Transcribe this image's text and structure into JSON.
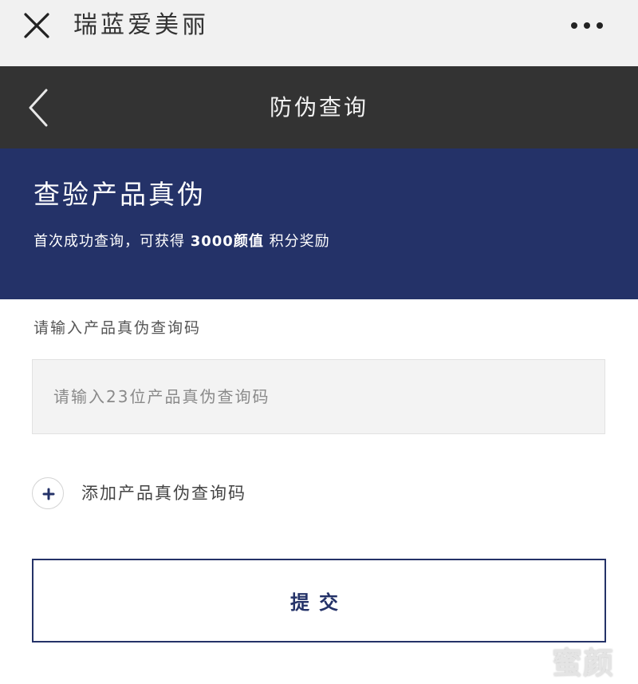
{
  "appbar": {
    "app_name": "瑞蓝爱美丽",
    "close_icon": "close-icon",
    "more_icon": "more-dots-icon"
  },
  "navbar": {
    "title": "防伪查询",
    "back_icon": "chevron-left-icon"
  },
  "banner": {
    "heading": "查验产品真伪",
    "sub_prefix": "首次成功查询，可获得 ",
    "sub_highlight": "3000颜值",
    "sub_suffix": " 积分奖励"
  },
  "form": {
    "label": "请输入产品真伪查询码",
    "input_value": "",
    "input_placeholder": "请输入23位产品真伪查询码",
    "add_label": "添加产品真伪查询码",
    "add_icon": "plus-icon",
    "submit_label": "提交"
  },
  "watermark": "蜜颜",
  "colors": {
    "appbar_bg": "#f1f1f1",
    "navbar_bg": "#333333",
    "brand_blue": "#243268",
    "input_bg": "#f3f3f3"
  }
}
